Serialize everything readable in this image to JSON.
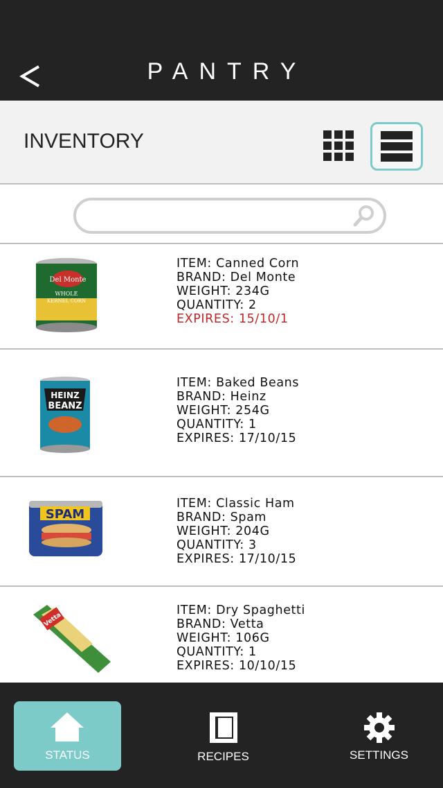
{
  "header": {
    "title": "PANTRY",
    "back_icon": "chevron-left-icon"
  },
  "subheader": {
    "label": "INVENTORY",
    "grid_icon": "grid-view-icon",
    "list_icon": "list-view-icon"
  },
  "search": {
    "value": "",
    "placeholder": "",
    "icon": "search-icon"
  },
  "items": [
    {
      "item": "ITEM: Canned Corn",
      "brand": "BRAND: Del Monte",
      "weight": "WEIGHT: 234G",
      "quantity": "QUANTITY: 2",
      "expires": "EXPIRES: 15/10/1",
      "expires_color": "#c0262b"
    },
    {
      "item": "ITEM: Baked Beans",
      "brand": "BRAND: Heinz",
      "weight": "WEIGHT: 254G",
      "quantity": "QUANTITY: 1",
      "expires": "EXPIRES: 17/10/15"
    },
    {
      "item": "ITEM: Classic Ham",
      "brand": "BRAND: Spam",
      "weight": "WEIGHT: 204G",
      "quantity": "QUANTITY: 3",
      "expires": "EXPIRES: 17/10/15"
    },
    {
      "item": "ITEM: Dry Spaghetti",
      "brand": "BRAND: Vetta",
      "weight": "WEIGHT: 106G",
      "quantity": "QUANTITY: 1",
      "expires": "EXPIRES: 10/10/15"
    }
  ],
  "product_labels": {
    "corn_brand": "Del Monte",
    "corn_line1": "WHOLE",
    "corn_line2": "KERNEL CORN",
    "beans_line1": "HEINZ",
    "beans_line2": "BEANZ",
    "ham_brand": "SPAM",
    "pasta_brand": "Vetta"
  },
  "tabs": [
    {
      "label": "STATUS",
      "icon": "home-icon",
      "active": true
    },
    {
      "label": "RECIPES",
      "icon": "book-icon",
      "active": false
    },
    {
      "label": "SETTINGS",
      "icon": "gear-icon",
      "active": false
    }
  ],
  "colors": {
    "accent": "#7ccbc9",
    "dark": "#232323",
    "expired": "#c0262b"
  }
}
